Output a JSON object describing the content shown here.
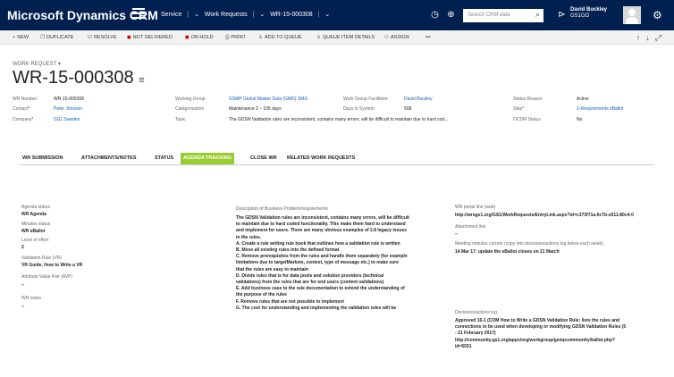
{
  "nav": {
    "brand": "Microsoft Dynamics CRM",
    "area": "Service",
    "separator": "|",
    "entity": "Work Requests",
    "record": "WR-15-000308",
    "chevron": "⌄",
    "search_placeholder": "Search CRM data",
    "user_name": "David Buckley",
    "user_org": "GS1GO"
  },
  "commands": {
    "new": "NEW",
    "duplicate": "DUPLICATE",
    "resolve": "RESOLVE",
    "not_delivered": "NOT DELIVERED",
    "on_hold": "ON HOLD",
    "print": "PRINT",
    "add_to_queue": "ADD TO QUEUE",
    "queue_item_details": "QUEUE ITEM DETAILS",
    "assign": "ASSIGN",
    "more": "•••"
  },
  "header": {
    "record_type": "WORK REQUEST",
    "record_type_caret": "▾",
    "title": "WR-15-000308",
    "title_menu": "≡"
  },
  "fields": {
    "wr_number_label": "WR Number",
    "wr_number_value": "WR-15-000308",
    "contact_label": "Contact",
    "contact_value": "Peter Jönsson",
    "company_label": "Company",
    "company_value": "GS1 Sweden",
    "working_group_label": "Working Group",
    "working_group_value": "GSMP Global Master Data (GMD) SMG",
    "categorization_label": "Categorization",
    "categorization_value": "Maintenance 2 – 105 days",
    "topic_label": "Topic",
    "topic_value": "The GDSN Validation rules are inconsistent, contains many errors, will be difficult to maintain due to hard cod...",
    "facilitator_label": "Work Group Facilitator",
    "facilitator_value": "David Buckley",
    "days_label": "Days in System",
    "days_value": "508",
    "status_reason_label": "Status Reason",
    "status_reason_value": "Active",
    "step_label": "Step",
    "step_value": "2-Requirements eBallot",
    "ocdm_label": "OCDM Status",
    "ocdm_value": "No",
    "required_mark": "*"
  },
  "tabs": [
    {
      "label": "WR SUBMISSION"
    },
    {
      "label": "ATTACHMENTS/NOTES"
    },
    {
      "label": "STATUS"
    },
    {
      "label": "AGENDA TRACKING"
    },
    {
      "label": "CLOSE WR"
    },
    {
      "label": "RELATED WORK REQUESTS"
    }
  ],
  "agenda": {
    "agenda_status_label": "Agenda status",
    "agenda_status_value": "WR Agenda",
    "minutes_status_label": "Minutes status",
    "minutes_status_value": "WR eBallot",
    "level_effort_label": "Level of effort",
    "level_effort_value": "2",
    "validation_rule_label": "Validation Rule (VR)",
    "validation_rule_value": "VR Guide, How to Write a VR",
    "attr_value_pair_label": "Attribute Value Pair (AVP)",
    "attr_value_pair_value": "--",
    "wr_notes_label": "WR notes",
    "wr_notes_value": "--",
    "description_label": "Description of Business Problem/requirements",
    "description_lines": [
      "The GDSN Validation rules are inconsistent, contains many errors, will be difficult",
      "to maintain due to hard coded functionality. This make them hard to understand",
      "and implement for users. There are many obvious examples of 2.8 legacy issues",
      "in the rules.",
      "A. Create a rule writing rule book that outlines how a validation rule is written",
      "B. Move all existing rules into the defined format",
      "C. Remove prerequisites from the rules and handle them separately (for example",
      "limitations due to targetMarkets, context, type of message etc.) to make sure",
      "that the rules are easy to maintain",
      "D. Divide rules that is for data pools and solution providers (technical",
      "validations) from the rules that are for end users (content validations)",
      "E. Add business case to the rule documentation to extend the understanding of",
      "the purpose of the rules",
      "F. Remove rules that are not possible to implement",
      "G. The cost for understanding and implementing the validation rules will be"
    ],
    "portal_link_label": "WR portal line (web)",
    "portal_link_value": "http://wrsgs1.org/GS1/WorkRequests/EntryLink.aspx?id=c373f71a-6c7b-e511-80c4-0",
    "attachment_label": "Attachment link",
    "attachment_value": "--",
    "meeting_minutes_label": "Meeting minutes current (copy into decisions/actions log below each week)",
    "meeting_minutes_value": "14 Mar 17: update the eBallot closes on 21 March",
    "decisions_label": "Decisions/actions log",
    "decisions_lines": [
      "Approved 16-1 (COM How to Write a GDSN Validation Rule; lists the rules and",
      "connections to be used when developing or modifying GDSN Validation Rules (5",
      "- 21 February 2017)",
      "http://community.gs1.org/apps/org/workgroup/gsmpcommunity/ballot.php?",
      "id=5031"
    ]
  }
}
